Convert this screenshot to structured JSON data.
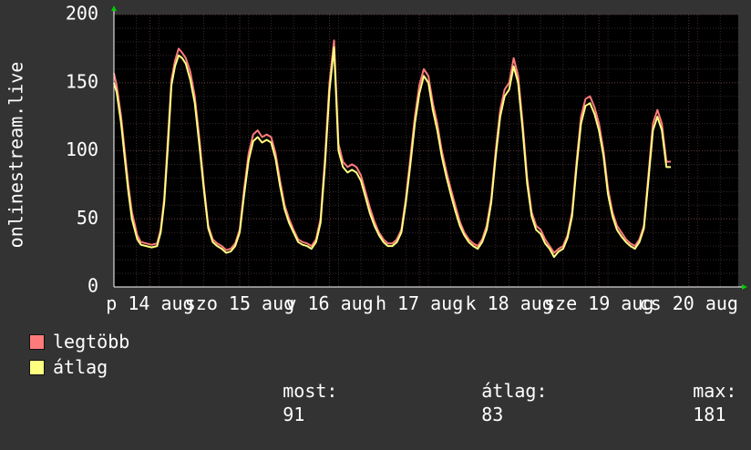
{
  "chart_data": {
    "type": "line",
    "ylabel": "onlinestream.live",
    "ylim": [
      0,
      200
    ],
    "yticks": [
      0,
      50,
      100,
      150,
      200
    ],
    "xlim": [
      0,
      6.95
    ],
    "xticks": [
      {
        "x": 0.4,
        "label": "p 14 aug"
      },
      {
        "x": 1.4,
        "label": "szo 15 aug"
      },
      {
        "x": 2.4,
        "label": "v 16 aug"
      },
      {
        "x": 3.4,
        "label": "h 17 aug"
      },
      {
        "x": 4.4,
        "label": "k 18 aug"
      },
      {
        "x": 5.4,
        "label": "sze 19 aug"
      },
      {
        "x": 6.4,
        "label": "cs 20 aug"
      }
    ],
    "grid": true,
    "colors": {
      "background": "#333333",
      "plot": "#000000",
      "grid_minor": "#3a2a2a",
      "grid_major": "#5a3535",
      "axis": "#ffffff",
      "arrow": "#00cc00",
      "max_series": "#ff7b7b",
      "avg_series": "#ffff80"
    },
    "key_points_x": [
      0,
      0.03,
      0.08,
      0.12,
      0.16,
      0.2,
      0.26,
      0.3,
      0.36,
      0.42,
      0.48,
      0.52,
      0.56,
      0.6,
      0.64,
      0.68,
      0.72,
      0.76,
      0.8,
      0.85,
      0.9,
      0.95,
      1.0,
      1.05,
      1.1,
      1.15,
      1.2,
      1.25,
      1.3,
      1.35,
      1.4,
      1.45,
      1.5,
      1.55,
      1.6,
      1.65,
      1.7,
      1.75,
      1.8,
      1.85,
      1.9,
      1.95,
      2.0,
      2.05,
      2.1,
      2.15,
      2.2,
      2.25,
      2.3,
      2.35,
      2.4,
      2.45,
      2.5,
      2.55,
      2.6,
      2.65,
      2.7,
      2.75,
      2.8,
      2.85,
      2.9,
      2.95,
      3.0,
      3.05,
      3.1,
      3.15,
      3.2,
      3.25,
      3.3,
      3.35,
      3.4,
      3.45,
      3.5,
      3.55,
      3.6,
      3.65,
      3.7,
      3.75,
      3.8,
      3.85,
      3.9,
      3.95,
      4.0,
      4.05,
      4.1,
      4.15,
      4.2,
      4.25,
      4.3,
      4.35,
      4.4,
      4.45,
      4.5,
      4.55,
      4.6,
      4.65,
      4.7,
      4.75,
      4.8,
      4.85,
      4.9,
      4.95,
      5.0,
      5.05,
      5.1,
      5.15,
      5.2,
      5.25,
      5.3,
      5.35,
      5.4,
      5.45,
      5.5,
      5.55,
      5.6,
      5.65,
      5.7,
      5.75,
      5.8,
      5.85,
      5.9,
      5.95,
      6.0,
      6.05,
      6.1,
      6.15,
      6.2,
      6.25,
      6.3,
      6.35,
      6.4,
      6.45,
      6.5,
      6.55,
      6.6,
      6.65,
      6.7,
      6.75,
      6.8,
      6.85,
      6.9,
      6.95
    ],
    "series": [
      {
        "name": "legtöbb",
        "values": [
          157,
          148,
          125,
          100,
          75,
          55,
          38,
          33,
          32,
          31,
          32,
          42,
          65,
          108,
          152,
          166,
          175,
          172,
          168,
          158,
          140,
          110,
          75,
          45,
          35,
          32,
          30,
          27,
          28,
          32,
          42,
          72,
          98,
          112,
          115,
          110,
          112,
          110,
          98,
          78,
          60,
          50,
          42,
          35,
          33,
          32,
          30,
          35,
          50,
          95,
          150,
          181,
          105,
          92,
          88,
          90,
          88,
          82,
          70,
          58,
          48,
          40,
          35,
          32,
          32,
          35,
          42,
          65,
          95,
          125,
          148,
          160,
          155,
          135,
          120,
          100,
          85,
          72,
          60,
          48,
          40,
          35,
          32,
          30,
          35,
          45,
          65,
          100,
          130,
          145,
          150,
          168,
          155,
          120,
          80,
          55,
          45,
          42,
          35,
          30,
          25,
          28,
          30,
          38,
          55,
          92,
          125,
          138,
          140,
          132,
          120,
          100,
          72,
          55,
          45,
          40,
          35,
          32,
          30,
          35,
          45,
          82,
          120,
          130,
          120,
          92,
          92
        ]
      },
      {
        "name": "átlag",
        "values": [
          150,
          143,
          120,
          95,
          70,
          50,
          35,
          31,
          30,
          29,
          30,
          40,
          62,
          102,
          148,
          162,
          170,
          168,
          164,
          152,
          135,
          105,
          72,
          43,
          33,
          30,
          28,
          25,
          26,
          30,
          40,
          68,
          93,
          107,
          110,
          106,
          108,
          106,
          94,
          74,
          57,
          47,
          40,
          33,
          31,
          30,
          28,
          33,
          47,
          90,
          144,
          176,
          100,
          88,
          84,
          86,
          84,
          78,
          66,
          54,
          45,
          38,
          33,
          30,
          30,
          33,
          40,
          62,
          90,
          120,
          142,
          155,
          150,
          130,
          115,
          96,
          81,
          68,
          56,
          45,
          38,
          33,
          30,
          28,
          33,
          42,
          62,
          96,
          125,
          140,
          145,
          162,
          150,
          115,
          76,
          52,
          42,
          39,
          32,
          28,
          22,
          26,
          28,
          36,
          52,
          88,
          120,
          133,
          135,
          127,
          115,
          96,
          68,
          52,
          42,
          37,
          33,
          30,
          28,
          33,
          43,
          78,
          115,
          125,
          115,
          88,
          88
        ]
      }
    ]
  },
  "legend": {
    "items": [
      {
        "label": "legtöbb",
        "color": "#ff7b7b"
      },
      {
        "label": "átlag",
        "color": "#ffff80"
      }
    ],
    "stats": {
      "now_label": "most:",
      "now_value": "91",
      "avg_label": "átlag:",
      "avg_value": "83",
      "max_label": "max:",
      "max_value": "181"
    }
  }
}
